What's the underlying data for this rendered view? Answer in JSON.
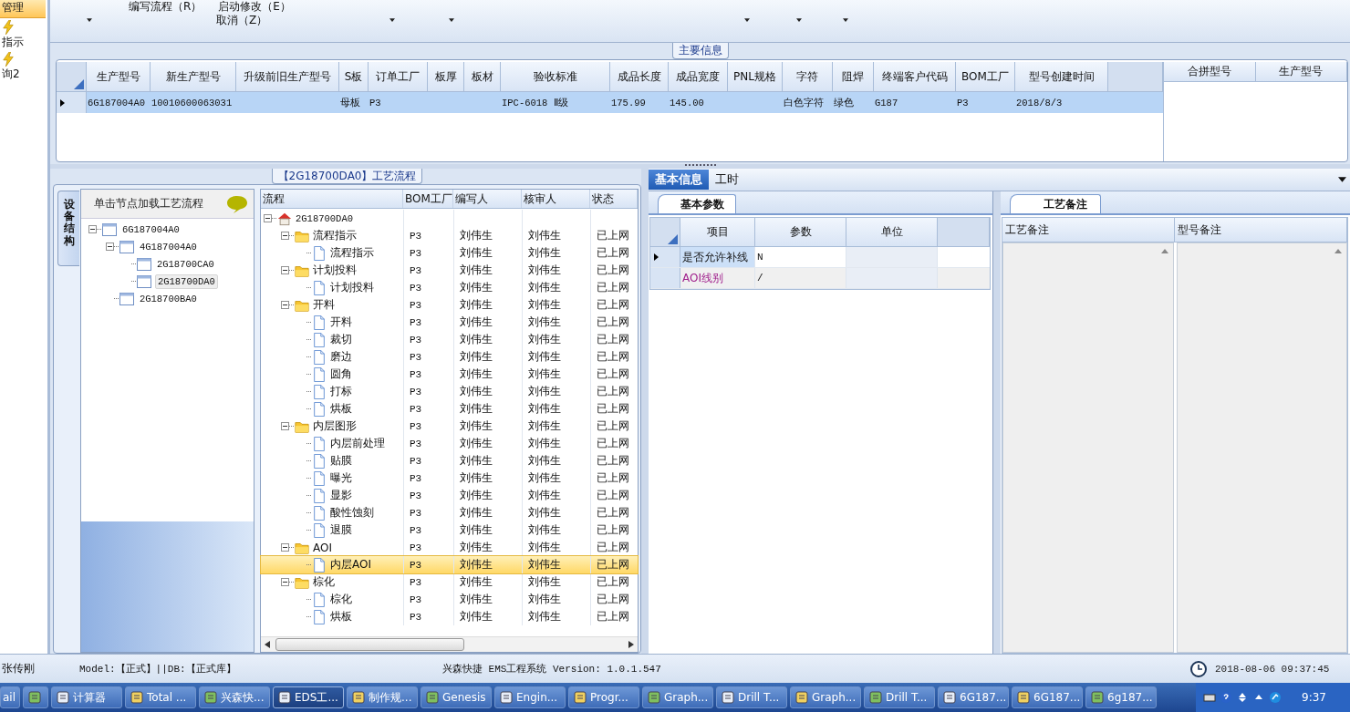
{
  "sidebar": {
    "items": [
      {
        "label": "管理",
        "selected": true
      },
      {
        "label": "指示",
        "selected": false
      },
      {
        "label": "询2",
        "selected": false
      }
    ]
  },
  "toolbar": {
    "row_1": [
      "编写流程（R）",
      "启动修改（E）"
    ],
    "row_2": [
      "取消（Z）"
    ]
  },
  "main_info": {
    "title": "主要信息",
    "table": {
      "columns": [
        "生产型号",
        "新生产型号",
        "升级前旧生产型号",
        "S板",
        "订单工厂",
        "板厚",
        "板材",
        "验收标准",
        "成品长度",
        "成品宽度",
        "PNL规格",
        "字符",
        "阻焊",
        "终端客户代码",
        "BOM工厂",
        "型号创建时间"
      ],
      "rows": [
        {
          "selected": true,
          "cells": [
            "6G187004A0",
            "10010600063031",
            null,
            "母板",
            "P3",
            null,
            null,
            "IPC-6018 Ⅱ级",
            "175.99",
            "145.00",
            null,
            "白色字符",
            "绿色",
            "G187",
            "P3",
            "2018/8/3"
          ]
        }
      ]
    },
    "side_table": {
      "columns": [
        "合拼型号",
        "生产型号"
      ]
    }
  },
  "process_panel": {
    "title": "【2G18700DA0】工艺流程",
    "side_tab": "设备结构",
    "tree_hint": "单击节点加载工艺流程"
  },
  "device_tree": {
    "nodes": [
      {
        "label": "6G187004A0",
        "expanded": true,
        "selected": false,
        "children": [
          {
            "label": "4G187004A0",
            "expanded": true,
            "selected": false,
            "children": [
              {
                "label": "2G18700CA0",
                "selected": false
              },
              {
                "label": "2G18700DA0",
                "selected": true
              }
            ]
          },
          {
            "label": "2G18700BA0",
            "selected": false
          }
        ]
      }
    ]
  },
  "flow_tree": {
    "columns": [
      "流程",
      "BOM工厂",
      "编写人",
      "核审人",
      "状态"
    ],
    "nodes": [
      {
        "kind": "root",
        "label": "2G18700DA0",
        "expanded": true,
        "selected": false,
        "children": [
          {
            "kind": "folder",
            "label": "流程指示",
            "bom": "P3",
            "writer": "刘伟生",
            "reviewer": "刘伟生",
            "status": "已上网",
            "expanded": true,
            "selected": false,
            "children": [
              {
                "kind": "step",
                "label": "流程指示",
                "bom": "P3",
                "writer": "刘伟生",
                "reviewer": "刘伟生",
                "status": "已上网",
                "selected": false
              }
            ]
          },
          {
            "kind": "folder",
            "label": "计划投料",
            "bom": "P3",
            "writer": "刘伟生",
            "reviewer": "刘伟生",
            "status": "已上网",
            "expanded": true,
            "selected": false,
            "children": [
              {
                "kind": "step",
                "label": "计划投料",
                "bom": "P3",
                "writer": "刘伟生",
                "reviewer": "刘伟生",
                "status": "已上网",
                "selected": false
              }
            ]
          },
          {
            "kind": "folder",
            "label": "开料",
            "bom": "P3",
            "writer": "刘伟生",
            "reviewer": "刘伟生",
            "status": "已上网",
            "expanded": true,
            "selected": false,
            "children": [
              {
                "kind": "step",
                "label": "开料",
                "bom": "P3",
                "writer": "刘伟生",
                "reviewer": "刘伟生",
                "status": "已上网",
                "selected": false
              },
              {
                "kind": "step",
                "label": "裁切",
                "bom": "P3",
                "writer": "刘伟生",
                "reviewer": "刘伟生",
                "status": "已上网",
                "selected": false
              },
              {
                "kind": "step",
                "label": "磨边",
                "bom": "P3",
                "writer": "刘伟生",
                "reviewer": "刘伟生",
                "status": "已上网",
                "selected": false
              },
              {
                "kind": "step",
                "label": "圆角",
                "bom": "P3",
                "writer": "刘伟生",
                "reviewer": "刘伟生",
                "status": "已上网",
                "selected": false
              },
              {
                "kind": "step",
                "label": "打标",
                "bom": "P3",
                "writer": "刘伟生",
                "reviewer": "刘伟生",
                "status": "已上网",
                "selected": false
              },
              {
                "kind": "step",
                "label": "烘板",
                "bom": "P3",
                "writer": "刘伟生",
                "reviewer": "刘伟生",
                "status": "已上网",
                "selected": false
              }
            ]
          },
          {
            "kind": "folder",
            "label": "内层图形",
            "bom": "P3",
            "writer": "刘伟生",
            "reviewer": "刘伟生",
            "status": "已上网",
            "expanded": true,
            "selected": false,
            "children": [
              {
                "kind": "step",
                "label": "内层前处理",
                "bom": "P3",
                "writer": "刘伟生",
                "reviewer": "刘伟生",
                "status": "已上网",
                "selected": false
              },
              {
                "kind": "step",
                "label": "贴膜",
                "bom": "P3",
                "writer": "刘伟生",
                "reviewer": "刘伟生",
                "status": "已上网",
                "selected": false
              },
              {
                "kind": "step",
                "label": "曝光",
                "bom": "P3",
                "writer": "刘伟生",
                "reviewer": "刘伟生",
                "status": "已上网",
                "selected": false
              },
              {
                "kind": "step",
                "label": "显影",
                "bom": "P3",
                "writer": "刘伟生",
                "reviewer": "刘伟生",
                "status": "已上网",
                "selected": false
              },
              {
                "kind": "step",
                "label": "酸性蚀刻",
                "bom": "P3",
                "writer": "刘伟生",
                "reviewer": "刘伟生",
                "status": "已上网",
                "selected": false
              },
              {
                "kind": "step",
                "label": "退膜",
                "bom": "P3",
                "writer": "刘伟生",
                "reviewer": "刘伟生",
                "status": "已上网",
                "selected": false
              }
            ]
          },
          {
            "kind": "folder",
            "label": "AOI",
            "bom": "P3",
            "writer": "刘伟生",
            "reviewer": "刘伟生",
            "status": "已上网",
            "expanded": true,
            "selected": false,
            "children": [
              {
                "kind": "step",
                "label": "内层AOI",
                "bom": "P3",
                "writer": "刘伟生",
                "reviewer": "刘伟生",
                "status": "已上网",
                "selected": true
              }
            ]
          },
          {
            "kind": "folder",
            "label": "棕化",
            "bom": "P3",
            "writer": "刘伟生",
            "reviewer": "刘伟生",
            "status": "已上网",
            "expanded": true,
            "selected": false,
            "children": [
              {
                "kind": "step",
                "label": "棕化",
                "bom": "P3",
                "writer": "刘伟生",
                "reviewer": "刘伟生",
                "status": "已上网",
                "selected": false
              },
              {
                "kind": "step",
                "label": "烘板",
                "bom": "P3",
                "writer": "刘伟生",
                "reviewer": "刘伟生",
                "status": "已上网",
                "selected": false
              }
            ]
          }
        ]
      }
    ]
  },
  "detail_tabs": [
    {
      "label": "基本信息",
      "selected": true
    },
    {
      "label": "工时",
      "selected": false
    }
  ],
  "params_panel": {
    "title": "基本参数",
    "columns": [
      "项目",
      "参数",
      "单位"
    ],
    "rows": [
      {
        "item": "是否允许补线",
        "value": "N",
        "highlighted": false,
        "selected": true
      },
      {
        "item": "AOI线别",
        "value": "/",
        "highlighted": true,
        "selected": false
      }
    ]
  },
  "notes_panel": {
    "title": "工艺备注",
    "columns": [
      "工艺备注",
      "型号备注"
    ]
  },
  "status_bar": {
    "user": "张传刚",
    "database": "Model:【正式】||DB:【正式库】",
    "app": "兴森快捷 EMS工程系统 Version: 1.0.1.547",
    "time": "2018-08-06 09:37:45"
  },
  "taskbar": {
    "items": [
      {
        "label": "ail",
        "selected": false
      },
      {
        "selected": false
      },
      {
        "label": "计算器",
        "selected": false
      },
      {
        "label": "Total ...",
        "selected": false
      },
      {
        "label": "兴森快...",
        "selected": false
      },
      {
        "label": "EDS工...",
        "selected": true
      },
      {
        "label": "制作规...",
        "selected": false
      },
      {
        "label": "Genesis",
        "selected": false
      },
      {
        "label": "Engin...",
        "selected": false
      },
      {
        "label": "Progr...",
        "selected": false
      },
      {
        "label": "Graph...",
        "selected": false
      },
      {
        "label": "Drill T...",
        "selected": false
      },
      {
        "label": "Graph...",
        "selected": false
      },
      {
        "label": "Drill T...",
        "selected": false
      },
      {
        "label": "6G187...",
        "selected": false
      },
      {
        "label": "6G187...",
        "selected": false
      },
      {
        "label": "6g187...",
        "selected": false
      }
    ],
    "clock": "9:37"
  }
}
